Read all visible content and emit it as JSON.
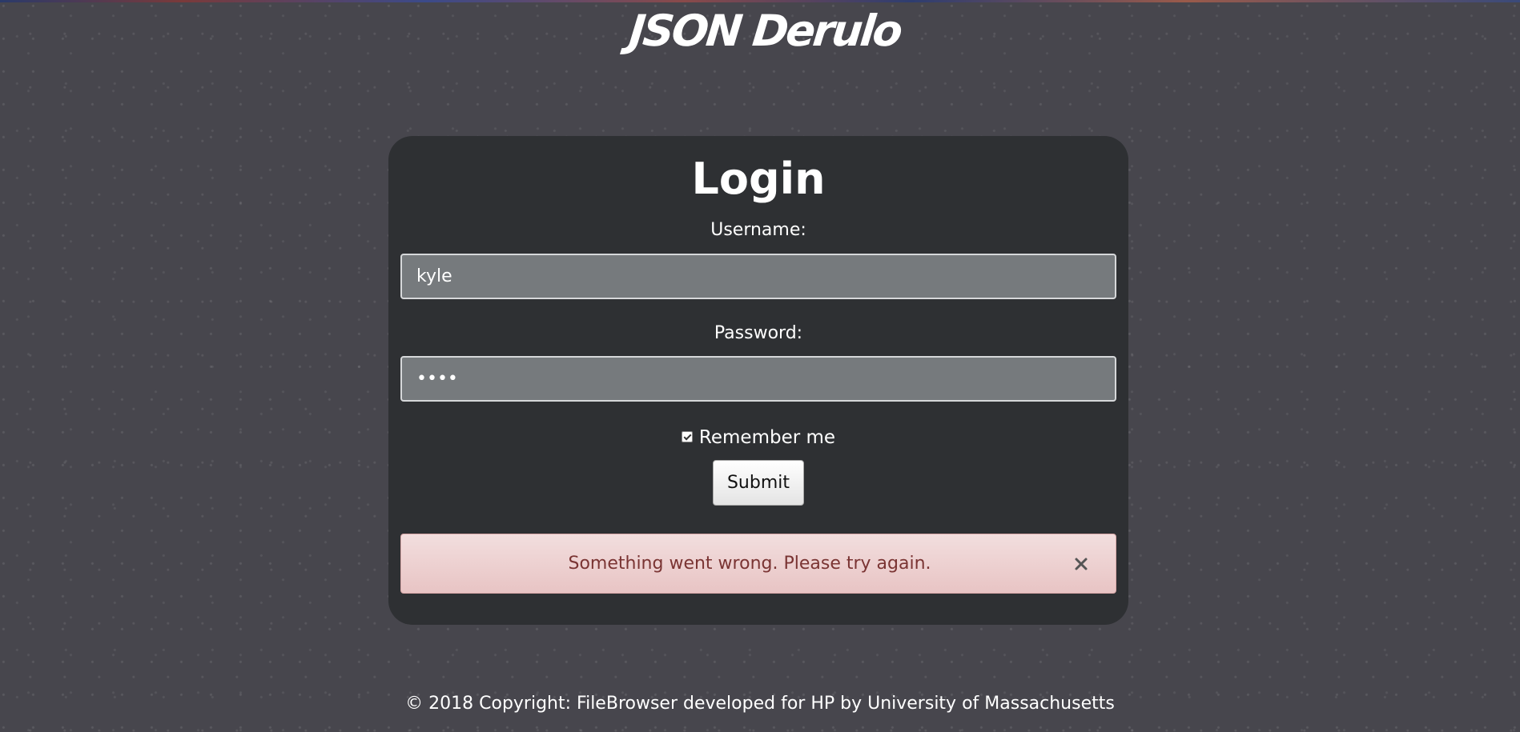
{
  "header": {
    "title": "JSON Derulo"
  },
  "login": {
    "heading": "Login",
    "username_label": "Username:",
    "username_value": "kyle",
    "password_label": "Password:",
    "password_value": "kyle",
    "remember_label": "Remember me",
    "remember_checked": true,
    "submit_label": "Submit"
  },
  "alert": {
    "message": "Something went wrong. Please try again.",
    "close_icon": "close-icon"
  },
  "footer": {
    "copyright": "© 2018 Copyright: FileBrowser developed for HP by University of Massachusetts"
  },
  "colors": {
    "background": "#47464d",
    "card": "#2e3033",
    "input": "#767a7d",
    "alert_bg": "#f2dede",
    "alert_text": "#7a3433"
  }
}
